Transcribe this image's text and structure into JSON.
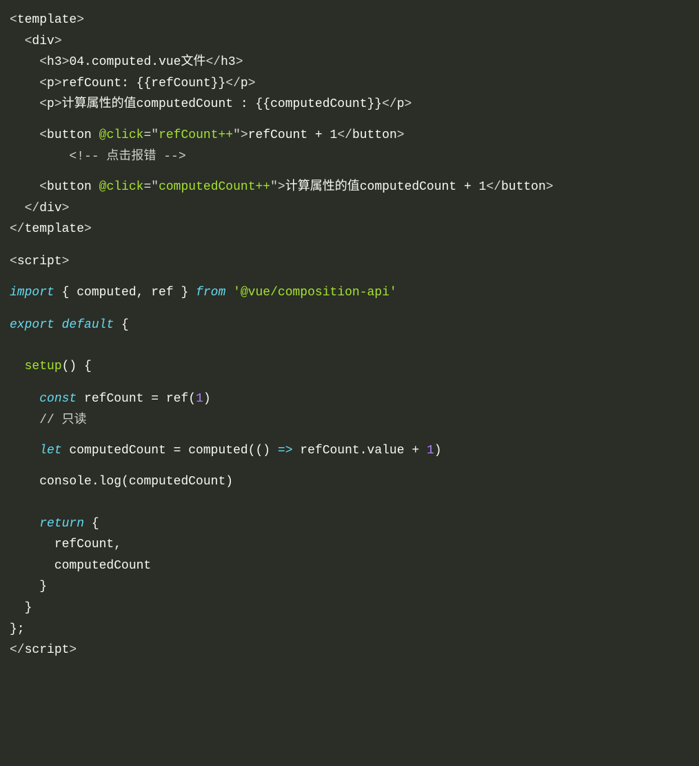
{
  "code": {
    "lines": [
      {
        "indent": 0,
        "type": "tag",
        "segments": [
          {
            "class": "punct",
            "text": "<"
          },
          {
            "class": "tag",
            "text": "template"
          },
          {
            "class": "punct",
            "text": ">"
          }
        ]
      },
      {
        "indent": 1,
        "type": "tag",
        "segments": [
          {
            "class": "punct",
            "text": "<"
          },
          {
            "class": "tag",
            "text": "div"
          },
          {
            "class": "punct",
            "text": ">"
          }
        ]
      },
      {
        "indent": 2,
        "type": "tag",
        "segments": [
          {
            "class": "punct",
            "text": "<"
          },
          {
            "class": "tag",
            "text": "h3"
          },
          {
            "class": "punct",
            "text": ">"
          },
          {
            "class": "default-text",
            "text": "04.computed.vue文件"
          },
          {
            "class": "punct",
            "text": "</"
          },
          {
            "class": "tag",
            "text": "h3"
          },
          {
            "class": "punct",
            "text": ">"
          }
        ]
      },
      {
        "indent": 2,
        "type": "tag",
        "segments": [
          {
            "class": "punct",
            "text": "<"
          },
          {
            "class": "tag",
            "text": "p"
          },
          {
            "class": "punct",
            "text": ">"
          },
          {
            "class": "default-text",
            "text": "refCount: {{refCount}}"
          },
          {
            "class": "punct",
            "text": "</"
          },
          {
            "class": "tag",
            "text": "p"
          },
          {
            "class": "punct",
            "text": ">"
          }
        ]
      },
      {
        "indent": 2,
        "type": "tag",
        "segments": [
          {
            "class": "punct",
            "text": "<"
          },
          {
            "class": "tag",
            "text": "p"
          },
          {
            "class": "punct",
            "text": ">"
          },
          {
            "class": "default-text",
            "text": "计算属性的值computedCount : {{computedCount}}"
          },
          {
            "class": "punct",
            "text": "</"
          },
          {
            "class": "tag",
            "text": "p"
          },
          {
            "class": "punct",
            "text": ">"
          }
        ]
      },
      {
        "indent": 2,
        "type": "tag",
        "segments": [
          {
            "class": "punct",
            "text": "<"
          },
          {
            "class": "tag",
            "text": "button"
          },
          {
            "class": "default-text",
            "text": " "
          },
          {
            "class": "attr",
            "text": "@click"
          },
          {
            "class": "punct",
            "text": "=\""
          },
          {
            "class": "attr",
            "text": "refCount++"
          },
          {
            "class": "punct",
            "text": "\">"
          },
          {
            "class": "default-text",
            "text": "refCount + 1"
          },
          {
            "class": "punct",
            "text": "</"
          },
          {
            "class": "tag",
            "text": "button"
          },
          {
            "class": "punct",
            "text": ">"
          }
        ]
      },
      {
        "indent": 4,
        "type": "comment",
        "segments": [
          {
            "class": "comment",
            "text": "<!-- 点击报错 -->"
          }
        ]
      },
      {
        "indent": 2,
        "type": "tag",
        "segments": [
          {
            "class": "punct",
            "text": "<"
          },
          {
            "class": "tag",
            "text": "button"
          },
          {
            "class": "default-text",
            "text": " "
          },
          {
            "class": "attr",
            "text": "@click"
          },
          {
            "class": "punct",
            "text": "=\""
          },
          {
            "class": "attr",
            "text": "computedCount++"
          },
          {
            "class": "punct",
            "text": "\">"
          },
          {
            "class": "default-text",
            "text": "计算属性的值computedCount + 1"
          },
          {
            "class": "punct",
            "text": "</"
          },
          {
            "class": "tag",
            "text": "button"
          },
          {
            "class": "punct",
            "text": ">"
          }
        ]
      },
      {
        "indent": 1,
        "type": "tag",
        "segments": [
          {
            "class": "punct",
            "text": "</"
          },
          {
            "class": "tag",
            "text": "div"
          },
          {
            "class": "punct",
            "text": ">"
          }
        ]
      },
      {
        "indent": 0,
        "type": "tag",
        "segments": [
          {
            "class": "punct",
            "text": "</"
          },
          {
            "class": "tag",
            "text": "template"
          },
          {
            "class": "punct",
            "text": ">"
          }
        ]
      },
      {
        "indent": 0,
        "type": "blank",
        "segments": []
      },
      {
        "indent": 0,
        "type": "tag",
        "segments": [
          {
            "class": "punct",
            "text": "<"
          },
          {
            "class": "tag",
            "text": "script"
          },
          {
            "class": "punct",
            "text": ">"
          }
        ]
      },
      {
        "indent": 0,
        "type": "js",
        "segments": [
          {
            "class": "keyword",
            "text": "import"
          },
          {
            "class": "default-text",
            "text": " { computed, ref } "
          },
          {
            "class": "keyword",
            "text": "from"
          },
          {
            "class": "default-text",
            "text": " "
          },
          {
            "class": "string",
            "text": "'@vue/composition-api'"
          }
        ]
      },
      {
        "indent": 0,
        "type": "blank",
        "segments": []
      },
      {
        "indent": 0,
        "type": "js",
        "segments": [
          {
            "class": "keyword",
            "text": "export"
          },
          {
            "class": "default-text",
            "text": " "
          },
          {
            "class": "keyword",
            "text": "default"
          },
          {
            "class": "default-text",
            "text": " {"
          }
        ]
      },
      {
        "indent": 0,
        "type": "blank",
        "segments": []
      },
      {
        "indent": 1,
        "type": "js",
        "segments": [
          {
            "class": "func",
            "text": "setup"
          },
          {
            "class": "default-text",
            "text": "() {"
          }
        ]
      },
      {
        "indent": 0,
        "type": "blank",
        "segments": []
      },
      {
        "indent": 2,
        "type": "js",
        "segments": [
          {
            "class": "const",
            "text": "const"
          },
          {
            "class": "default-text",
            "text": " refCount = ref("
          },
          {
            "class": "number",
            "text": "1"
          },
          {
            "class": "default-text",
            "text": ")"
          }
        ]
      },
      {
        "indent": 2,
        "type": "js",
        "segments": [
          {
            "class": "comment",
            "text": "// 只读"
          }
        ]
      },
      {
        "indent": 2,
        "type": "js",
        "segments": [
          {
            "class": "const",
            "text": "let"
          },
          {
            "class": "default-text",
            "text": " computedCount = computed(() "
          },
          {
            "class": "const",
            "text": "=>"
          },
          {
            "class": "default-text",
            "text": " refCount.value + "
          },
          {
            "class": "number",
            "text": "1"
          },
          {
            "class": "default-text",
            "text": ")"
          }
        ]
      },
      {
        "indent": 2,
        "type": "js",
        "segments": [
          {
            "class": "default-text",
            "text": "console.log(computedCount)"
          }
        ]
      },
      {
        "indent": 0,
        "type": "blank",
        "segments": []
      },
      {
        "indent": 2,
        "type": "js",
        "segments": [
          {
            "class": "keyword",
            "text": "return"
          },
          {
            "class": "default-text",
            "text": " {"
          }
        ]
      },
      {
        "indent": 3,
        "type": "js",
        "segments": [
          {
            "class": "default-text",
            "text": "refCount,"
          }
        ]
      },
      {
        "indent": 3,
        "type": "js",
        "segments": [
          {
            "class": "default-text",
            "text": "computedCount"
          }
        ]
      },
      {
        "indent": 2,
        "type": "js",
        "segments": [
          {
            "class": "default-text",
            "text": "}"
          }
        ]
      },
      {
        "indent": 1,
        "type": "js",
        "segments": [
          {
            "class": "default-text",
            "text": "}"
          }
        ]
      },
      {
        "indent": 0,
        "type": "js",
        "segments": [
          {
            "class": "default-text",
            "text": "};"
          }
        ]
      },
      {
        "indent": 0,
        "type": "tag",
        "segments": [
          {
            "class": "punct",
            "text": "</"
          },
          {
            "class": "tag",
            "text": "script"
          },
          {
            "class": "punct",
            "text": ">"
          }
        ]
      }
    ]
  },
  "indentUnit": "  ",
  "spacedLines": [
    5,
    7,
    12,
    16,
    20,
    21,
    23
  ]
}
